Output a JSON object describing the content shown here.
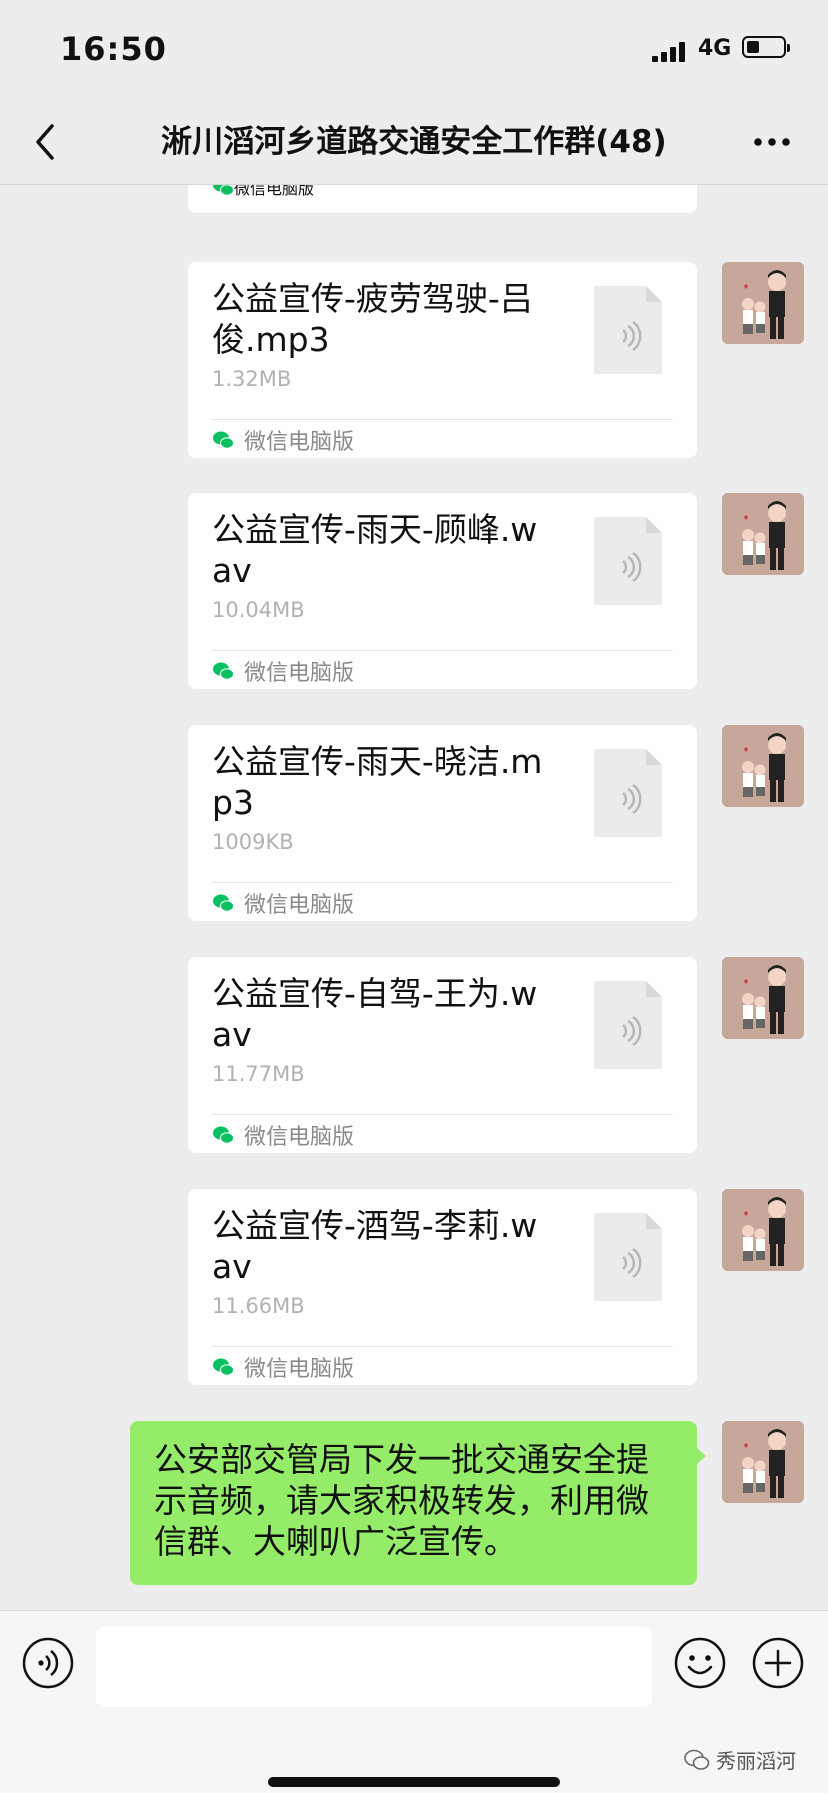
{
  "status_bar": {
    "time": "16:50",
    "network": "4G"
  },
  "header": {
    "title": "淅川滔河乡道路交通安全工作群(48)",
    "back_icon": "chevron-left-icon",
    "more_icon": "more-dots-icon"
  },
  "top_partial_card": {
    "source_label": "微信电脑版"
  },
  "messages": [
    {
      "file_name": "公益宣传-疲劳驾驶-吕俊.mp3",
      "file_size": "1.32MB",
      "source_label": "微信电脑版"
    },
    {
      "file_name": "公益宣传-雨天-顾峰.wav",
      "file_size": "10.04MB",
      "source_label": "微信电脑版"
    },
    {
      "file_name": "公益宣传-雨天-晓洁.mp3",
      "file_size": "1009KB",
      "source_label": "微信电脑版"
    },
    {
      "file_name": "公益宣传-自驾-王为.wav",
      "file_size": "11.77MB",
      "source_label": "微信电脑版"
    },
    {
      "file_name": "公益宣传-酒驾-李莉.wav",
      "file_size": "11.66MB",
      "source_label": "微信电脑版"
    }
  ],
  "text_message": {
    "text": "公安部交管局下发一批交通安全提示音频，请大家积极转发，利用微信群、大喇叭广泛宣传。"
  },
  "input_bar": {
    "voice_icon": "voice-icon",
    "emoji_icon": "emoji-icon",
    "plus_icon": "plus-icon"
  },
  "watermark": {
    "text": "秀丽滔河"
  },
  "colors": {
    "background": "#ededed",
    "sent_bubble": "#95ec69",
    "card": "#ffffff",
    "wechat_green": "#07c160"
  }
}
